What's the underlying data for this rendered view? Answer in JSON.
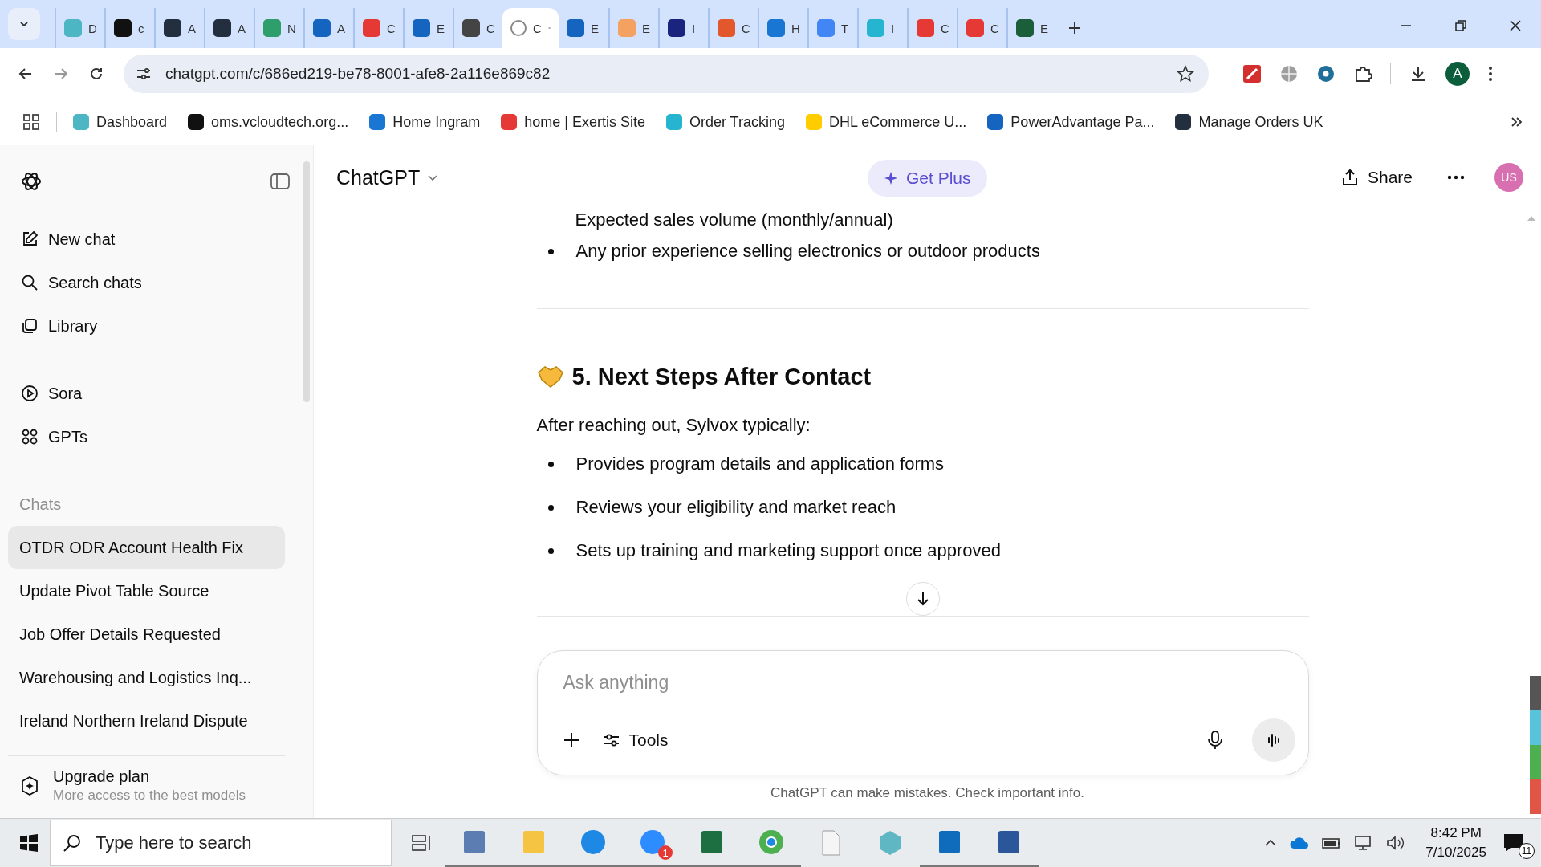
{
  "browser": {
    "tabs": [
      {
        "label": "D",
        "color": "#4db6c4",
        "selected": false
      },
      {
        "label": "c",
        "color": "#111111",
        "selected": false
      },
      {
        "label": "A",
        "color": "#232f3e",
        "selected": false
      },
      {
        "label": "A",
        "color": "#232f3e",
        "selected": false
      },
      {
        "label": "N",
        "color": "#2e9e6b",
        "selected": false
      },
      {
        "label": "A",
        "color": "#1565c0",
        "selected": false
      },
      {
        "label": "C",
        "color": "#e53935",
        "selected": false
      },
      {
        "label": "E",
        "color": "#1565c0",
        "selected": false
      },
      {
        "label": "C",
        "color": "#444444",
        "selected": false
      },
      {
        "label": "C",
        "color": "#888888",
        "selected": true
      },
      {
        "label": "E",
        "color": "#1565c0",
        "selected": false
      },
      {
        "label": "E",
        "color": "#f4a261",
        "selected": false
      },
      {
        "label": "I",
        "color": "#1a237e",
        "selected": false
      },
      {
        "label": "C",
        "color": "#e2572b",
        "selected": false
      },
      {
        "label": "H",
        "color": "#1976d2",
        "selected": false
      },
      {
        "label": "T",
        "color": "#4285f4",
        "selected": false
      },
      {
        "label": "I",
        "color": "#26b5d0",
        "selected": false
      },
      {
        "label": "C",
        "color": "#e53935",
        "selected": false
      },
      {
        "label": "C",
        "color": "#e53935",
        "selected": false
      },
      {
        "label": "E",
        "color": "#1b5e3a",
        "selected": false
      }
    ],
    "address": "chatgpt.com/c/686ed219-be78-8001-afe8-2a116e869c82",
    "profile": "A",
    "bookmarks": [
      {
        "label": "Dashboard",
        "color": "#4db6c4"
      },
      {
        "label": "oms.vcloudtech.org...",
        "color": "#111111"
      },
      {
        "label": "Home Ingram",
        "color": "#1976d2"
      },
      {
        "label": "home | Exertis Site",
        "color": "#e53935"
      },
      {
        "label": "Order Tracking",
        "color": "#26b5d0"
      },
      {
        "label": "DHL eCommerce U...",
        "color": "#ffcc00"
      },
      {
        "label": "PowerAdvantage Pa...",
        "color": "#1565c0"
      },
      {
        "label": "Manage Orders UK",
        "color": "#232f3e"
      }
    ]
  },
  "sidebar": {
    "nav": [
      {
        "label": "New chat",
        "kind": "edit"
      },
      {
        "label": "Search chats",
        "kind": "search"
      },
      {
        "label": "Library",
        "kind": "library"
      },
      {
        "label": "Sora",
        "kind": "play"
      },
      {
        "label": "GPTs",
        "kind": "grid"
      }
    ],
    "chats_heading": "Chats",
    "chats": [
      {
        "label": "OTDR ODR Account Health Fix",
        "selected": true
      },
      {
        "label": "Update Pivot Table Source",
        "selected": false
      },
      {
        "label": "Job Offer Details Requested",
        "selected": false
      },
      {
        "label": "Warehousing and Logistics Inq...",
        "selected": false
      },
      {
        "label": "Ireland Northern Ireland Dispute",
        "selected": false
      }
    ],
    "upgrade": {
      "title": "Upgrade plan",
      "subtitle": "More access to the best models"
    }
  },
  "header": {
    "title": "ChatGPT",
    "cta": "Get Plus",
    "share": "Share",
    "avatar": "US"
  },
  "message": {
    "cut_line": "Expected sales volume (monthly/annual)",
    "bullets_top": [
      "Any prior experience selling electronics or outdoor products"
    ],
    "heading": "5. Next Steps After Contact",
    "intro": "After reaching out, Sylvox typically:",
    "bullets": [
      "Provides program details and application forms",
      "Reviews your eligibility and market reach",
      "Sets up training and marketing support once approved"
    ]
  },
  "composer": {
    "placeholder": "Ask anything",
    "tools": "Tools"
  },
  "disclaimer": "ChatGPT can make mistakes. Check important info.",
  "taskbar": {
    "search_placeholder": "Type here to search",
    "apps": [
      {
        "kind": "calculator",
        "color": "#5b7db1",
        "running": true
      },
      {
        "kind": "folder",
        "color": "#f6c443",
        "running": true
      },
      {
        "kind": "edge",
        "color": "#1e88e5",
        "running": true
      },
      {
        "kind": "zoom",
        "color": "#2d8cff",
        "running": true,
        "badge": "1"
      },
      {
        "kind": "excel",
        "color": "#1d6f42",
        "running": true
      },
      {
        "kind": "chrome",
        "color": "#4caf50",
        "running": true
      },
      {
        "kind": "file",
        "color": "#f5f5f5",
        "running": false
      },
      {
        "kind": "hex",
        "color": "#5fb7c4",
        "running": false
      },
      {
        "kind": "outlook",
        "color": "#0f6cbd",
        "running": true
      },
      {
        "kind": "word",
        "color": "#2b579a",
        "running": true
      }
    ],
    "time": "8:42 PM",
    "date": "7/10/2025",
    "notifications": "11"
  }
}
